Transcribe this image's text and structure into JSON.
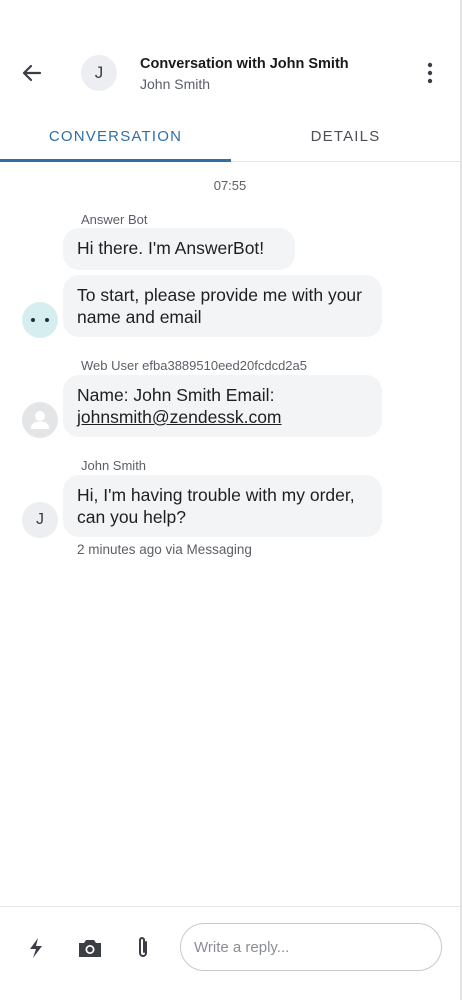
{
  "header": {
    "back_icon": "arrow-left-icon",
    "avatar_initial": "J",
    "title": "Conversation with John Smith",
    "subtitle": "John Smith",
    "menu_icon": "more-vertical-icon"
  },
  "tabs": [
    {
      "label": "CONVERSATION",
      "active": true
    },
    {
      "label": "DETAILS",
      "active": false
    }
  ],
  "conversation": {
    "timestamp": "07:55",
    "groups": [
      {
        "sender": "Answer Bot",
        "avatar": "bot-avatar-icon",
        "messages": [
          "Hi there. I'm AnswerBot!",
          "To start, please provide me with your name and email"
        ]
      },
      {
        "sender": "Web User efba3889510eed20fcdcd2a5",
        "avatar": "user-silhouette-icon",
        "message_prefix": "Name: John Smith Email:",
        "message_link": "johnsmith@zendessk.com"
      },
      {
        "sender": "John Smith",
        "avatar_initial": "J",
        "messages": [
          "Hi, I'm having trouble with my order, can you help?"
        ],
        "meta": "2 minutes ago via Messaging"
      }
    ]
  },
  "composer": {
    "icons": [
      "lightning-icon",
      "camera-icon",
      "paperclip-icon"
    ],
    "placeholder": "Write a reply..."
  },
  "colors": {
    "accent": "#2f6fa5",
    "bubble": "#f3f4f6",
    "bot_avatar": "#d7eef1"
  }
}
